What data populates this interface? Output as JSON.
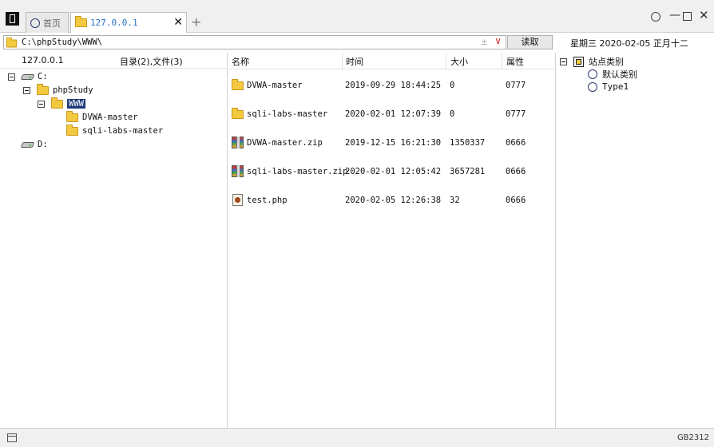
{
  "tabs": [
    {
      "label": "首页",
      "icon": "circle-icon",
      "active": false
    },
    {
      "label": "127.0.0.1",
      "icon": "folder-icon",
      "active": true
    }
  ],
  "address": {
    "path": "C:\\phpStudy\\WWW\\",
    "plusminus": "±",
    "dropdown": "∨"
  },
  "read_button": "读取",
  "date": "星期三  2020-02-05  正月十二",
  "left": {
    "host": "127.0.0.1",
    "count": "目录(2),文件(3)",
    "tree": [
      {
        "label": "C:",
        "icon": "drive-icon"
      },
      {
        "label": "phpStudy",
        "icon": "folder-icon"
      },
      {
        "label": "WWW",
        "icon": "folder-open-icon",
        "selected": true
      },
      {
        "label": "DVWA-master",
        "icon": "folder-icon"
      },
      {
        "label": "sqli-labs-master",
        "icon": "folder-icon"
      },
      {
        "label": "D:",
        "icon": "drive-icon"
      }
    ]
  },
  "files": {
    "columns": [
      "名称",
      "时间",
      "大小",
      "属性"
    ],
    "rows": [
      {
        "name": "DVWA-master",
        "time": "2019-09-29 18:44:25",
        "size": "0",
        "attr": "0777",
        "icon": "folder-icon"
      },
      {
        "name": "sqli-labs-master",
        "time": "2020-02-01 12:07:39",
        "size": "0",
        "attr": "0777",
        "icon": "folder-icon"
      },
      {
        "name": "DVWA-master.zip",
        "time": "2019-12-15 16:21:30",
        "size": "1350337",
        "attr": "0666",
        "icon": "zip-icon"
      },
      {
        "name": "sqli-labs-master.zip",
        "time": "2020-02-01 12:05:42",
        "size": "3657281",
        "attr": "0666",
        "icon": "zip-icon"
      },
      {
        "name": "test.php",
        "time": "2020-02-05 12:26:38",
        "size": "32",
        "attr": "0666",
        "icon": "php-file-icon"
      }
    ]
  },
  "right": {
    "root": "站点类别",
    "children": [
      "默认类别",
      "Type1"
    ]
  },
  "status": {
    "encoding": "GB2312"
  }
}
